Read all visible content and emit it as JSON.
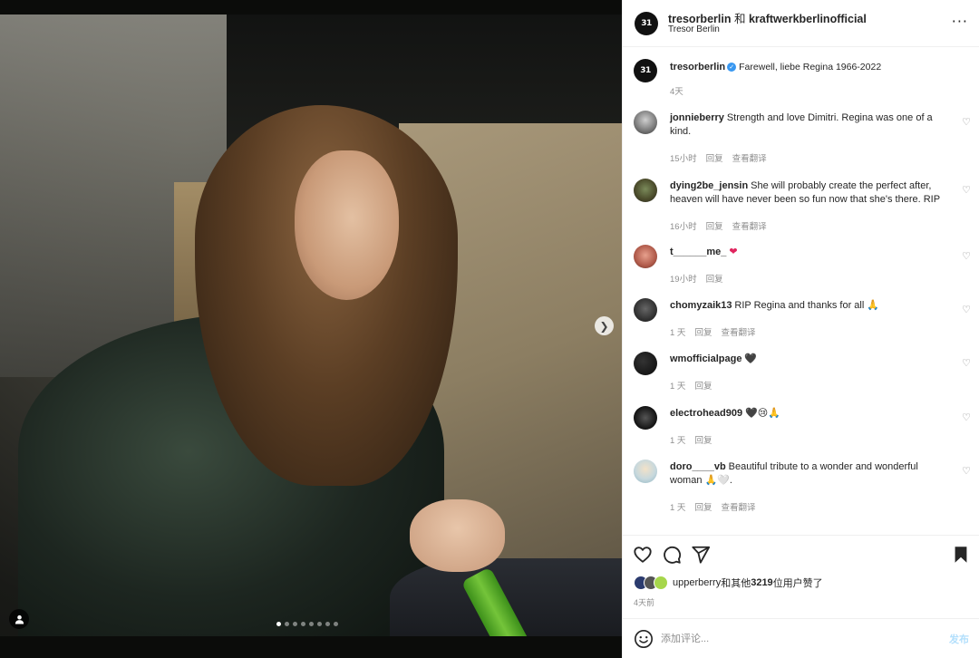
{
  "post": {
    "header": {
      "title_user1": "tresorberlin",
      "title_and": "和",
      "title_user2": "kraftwerkberlinofficial",
      "location": "Tresor Berlin",
      "avatar_text": "31",
      "more": "···"
    },
    "photo": {
      "slide_count": 8,
      "active_slide": 1
    },
    "caption": {
      "user": "tresorberlin",
      "verified": true,
      "text": "Farewell, liebe Regina 1966-2022",
      "time": "4天"
    },
    "comments": [
      {
        "user": "jonnieberry",
        "text": "Strength and love Dimitri. Regina was one of a kind.",
        "time": "15小时",
        "reply": "回复",
        "translate": "查看翻译"
      },
      {
        "user": "dying2be_jensin",
        "text": "She will probably create the perfect after, heaven will have never been so fun now that she's there. RIP",
        "time": "16小时",
        "reply": "回复",
        "translate": "查看翻译"
      },
      {
        "user": "t______me_",
        "text": "❤",
        "time": "19小时",
        "reply": "回复",
        "translate": ""
      },
      {
        "user": "chomyzaik13",
        "text": "RIP Regina and thanks for all 🙏",
        "time": "1 天",
        "reply": "回复",
        "translate": "查看翻译"
      },
      {
        "user": "wmofficialpage",
        "text": "🖤",
        "time": "1 天",
        "reply": "回复",
        "translate": ""
      },
      {
        "user": "electrohead909",
        "text": "🖤😢🙏",
        "time": "1 天",
        "reply": "回复",
        "translate": ""
      },
      {
        "user": "doro____vb",
        "text": "Beautiful tribute to a wonder and wonderful woman 🙏🤍.",
        "time": "1 天",
        "reply": "回复",
        "translate": "查看翻译"
      }
    ],
    "likes": {
      "first_user": "upperberry",
      "middle": "和其他",
      "count": "3219",
      "suffix": " 位用户赞了"
    },
    "posted_ago": "4天前",
    "composer": {
      "placeholder": "添加评论...",
      "post_label": "发布"
    },
    "colors": {
      "verified_blue": "#3897f0",
      "post_button_disabled": "#b2dffc",
      "like_heart_red": "#e0245e"
    },
    "icons": [
      "heart-icon",
      "comment-icon",
      "share-icon",
      "bookmark-icon",
      "emoji-icon",
      "user-tag-icon",
      "chevron-right-icon",
      "more-icon"
    ]
  }
}
